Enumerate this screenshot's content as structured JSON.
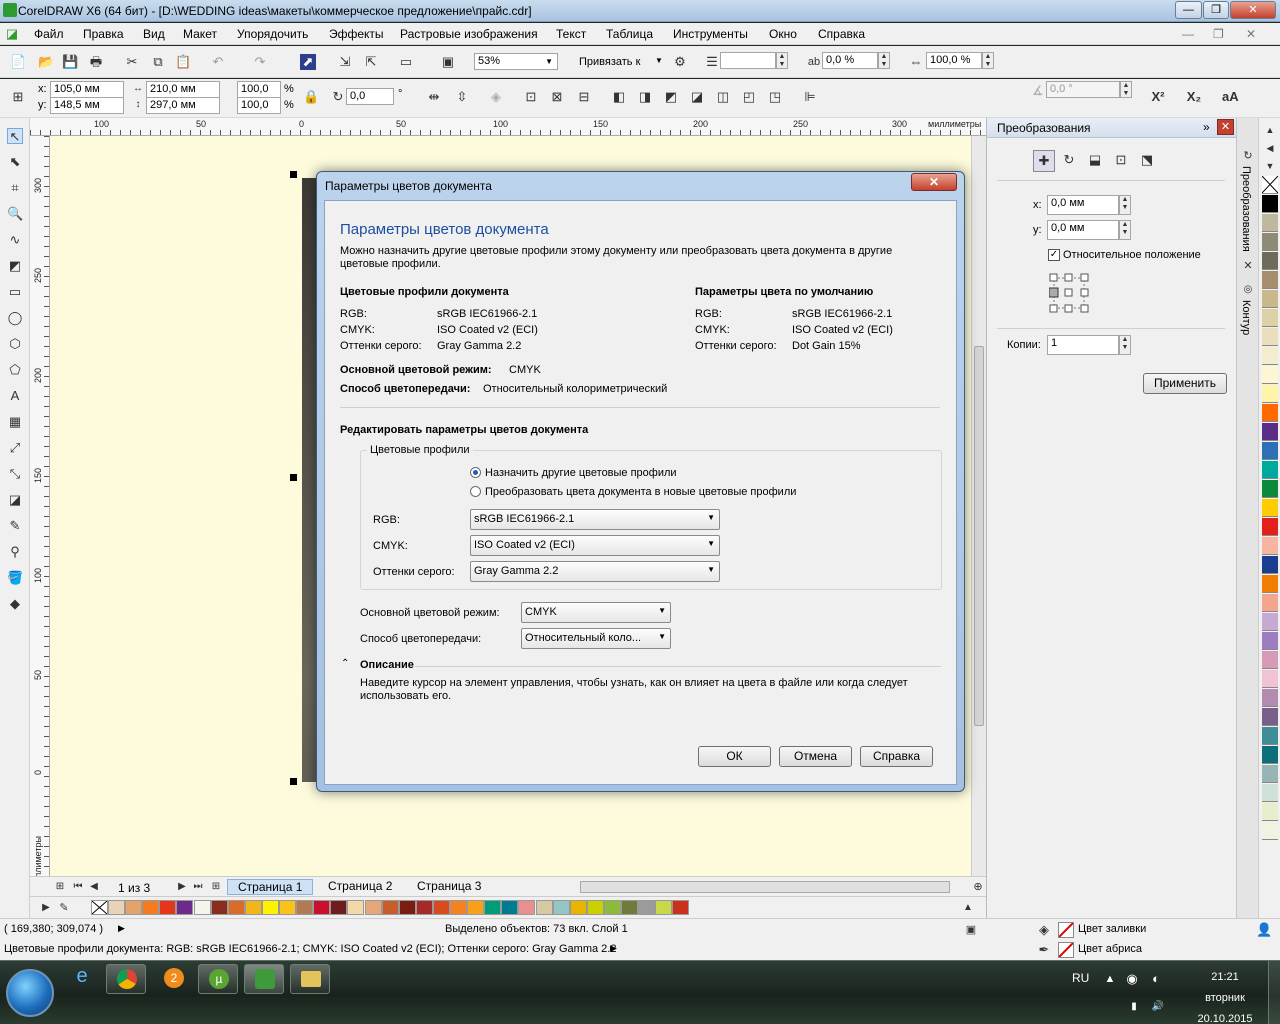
{
  "window": {
    "title": "CorelDRAW X6 (64 бит) - [D:\\WEDDING ideas\\макеты\\коммерческое предложение\\прайс.cdr]"
  },
  "menu": [
    "Файл",
    "Правка",
    "Вид",
    "Макет",
    "Упорядочить",
    "Эффекты",
    "Растровые изображения",
    "Текст",
    "Таблица",
    "Инструменты",
    "Окно",
    "Справка"
  ],
  "toolbar": {
    "zoom": "53%",
    "snap_label": "Привязать к",
    "pct1": "0,0 %",
    "pct2": "100,0 %"
  },
  "propbar": {
    "x": "105,0 мм",
    "y": "148,5 мм",
    "w": "210,0 мм",
    "h": "297,0 мм",
    "sx": "100,0",
    "sy": "100,0",
    "pct": "%",
    "rot": "0,0",
    "deg": "°",
    "angle": "0,0 °",
    "x_label": "x:",
    "y_label": "y:"
  },
  "ruler": {
    "h_ticks": [
      "100",
      "50",
      "0",
      "50",
      "100",
      "150",
      "200",
      "250",
      "300"
    ],
    "h_unit": "миллиметры",
    "v_ticks": [
      "300",
      "250",
      "200",
      "150",
      "100",
      "50",
      "0"
    ],
    "v_unit": "миллиметры"
  },
  "pages": {
    "counter": "1 из 3",
    "tabs": [
      "Страница 1",
      "Страница 2",
      "Страница 3"
    ]
  },
  "status": {
    "coords": "( 169,380; 309,074 )",
    "selection": "Выделено объектов: 73 вкл. Слой 1",
    "fill": "Цвет заливки",
    "outline": "Цвет абриса",
    "profile": "Цветовые профили документа: RGB: sRGB IEC61966-2.1; CMYK: ISO Coated v2 (ECI); Оттенки серого: Gray Gamma 2.2"
  },
  "docker": {
    "title": "Преобразования",
    "x_label": "x:",
    "x_val": "0,0 мм",
    "y_label": "y:",
    "y_val": "0,0 мм",
    "relative": "Относительное положение",
    "copies_label": "Копии:",
    "copies_val": "1",
    "apply": "Применить",
    "vtab1": "Преобразования",
    "vtab2": "Контур"
  },
  "dialog": {
    "title": "Параметры цветов документа",
    "heading": "Параметры цветов документа",
    "intro": "Можно назначить другие цветовые профили этому документу или преобразовать цвета документа в другие цветовые профили.",
    "doc_profiles_title": "Цветовые профили документа",
    "default_title": "Параметры цвета по умолчанию",
    "rgb_label": "RGB:",
    "cmyk_label": "CMYK:",
    "gray_label": "Оттенки серого:",
    "doc_rgb": "sRGB IEC61966-2.1",
    "doc_cmyk": "ISO Coated v2 (ECI)",
    "doc_gray": "Gray Gamma 2.2",
    "def_rgb": "sRGB IEC61966-2.1",
    "def_cmyk": "ISO Coated v2 (ECI)",
    "def_gray": "Dot Gain 15%",
    "mode_label": "Основной цветовой режим:",
    "mode_val": "CMYK",
    "render_label": "Способ цветопередачи:",
    "render_val": "Относительный колориметрический",
    "edit_title": "Редактировать параметры цветов документа",
    "group_title": "Цветовые профили",
    "radio_assign": "Назначить другие цветовые профили",
    "radio_convert": "Преобразовать цвета документа в новые цветовые профили",
    "sel_rgb": "sRGB IEC61966-2.1",
    "sel_cmyk": "ISO Coated v2 (ECI)",
    "sel_gray": "Gray Gamma 2.2",
    "mode2_label": "Основной цветовой режим:",
    "mode2_val": "CMYK",
    "render2_label": "Способ цветопередачи:",
    "render2_val": "Относительный коло...",
    "desc_title": "Описание",
    "desc_text": "Наведите курсор на элемент управления, чтобы узнать, как он влияет на цвета в файле или когда следует использовать его.",
    "ok": "ОК",
    "cancel": "Отмена",
    "help": "Справка"
  },
  "taskbar": {
    "lang": "RU",
    "time": "21:21",
    "day": "вторник",
    "date": "20.10.2015"
  },
  "palette_bottom": [
    "#e8d3b8",
    "#e3a36b",
    "#f47b20",
    "#e5361b",
    "#6c2b8a",
    "#f7f4ec",
    "#8b2b1e",
    "#d96b2b",
    "#f2b61c",
    "#fff200",
    "#f9c31b",
    "#b07a52",
    "#c8102e",
    "#6d1d1d",
    "#f4d9a8",
    "#e6a67a",
    "#c65d2a",
    "#7a1c12",
    "#a52a2a",
    "#d84b20",
    "#f58220",
    "#f9a01b",
    "#009b77",
    "#007c91",
    "#e88f8f",
    "#d5c9a3",
    "#93c6c4",
    "#e8b400",
    "#c9d200",
    "#8cba3a",
    "#6e7b3a",
    "#9b9b9b",
    "#c8d84a",
    "#c9311c"
  ],
  "palette_right": [
    "#ffffff",
    "#000000",
    "#bfb89f",
    "#8f8a74",
    "#6e6b5c",
    "#a58e6b",
    "#c9b98a",
    "#ddd1a7",
    "#e9dfbd",
    "#f4eccf",
    "#fdf6d4",
    "#fff4a8",
    "#ff6a00",
    "#5b2d86",
    "#2e6fb7",
    "#00a99d",
    "#0b8a3c",
    "#ffcc00",
    "#e32119",
    "#f7b4a1",
    "#1a3d8f",
    "#ef7d00",
    "#f5a58c",
    "#c7a9d6",
    "#9e7cc1",
    "#d49ab8",
    "#efc3d3",
    "#b48bb0",
    "#7a5f8a",
    "#3f8d96",
    "#0c6f7a",
    "#97b5b5",
    "#cfe1d8",
    "#e6eecb",
    "#f2f2e0"
  ]
}
